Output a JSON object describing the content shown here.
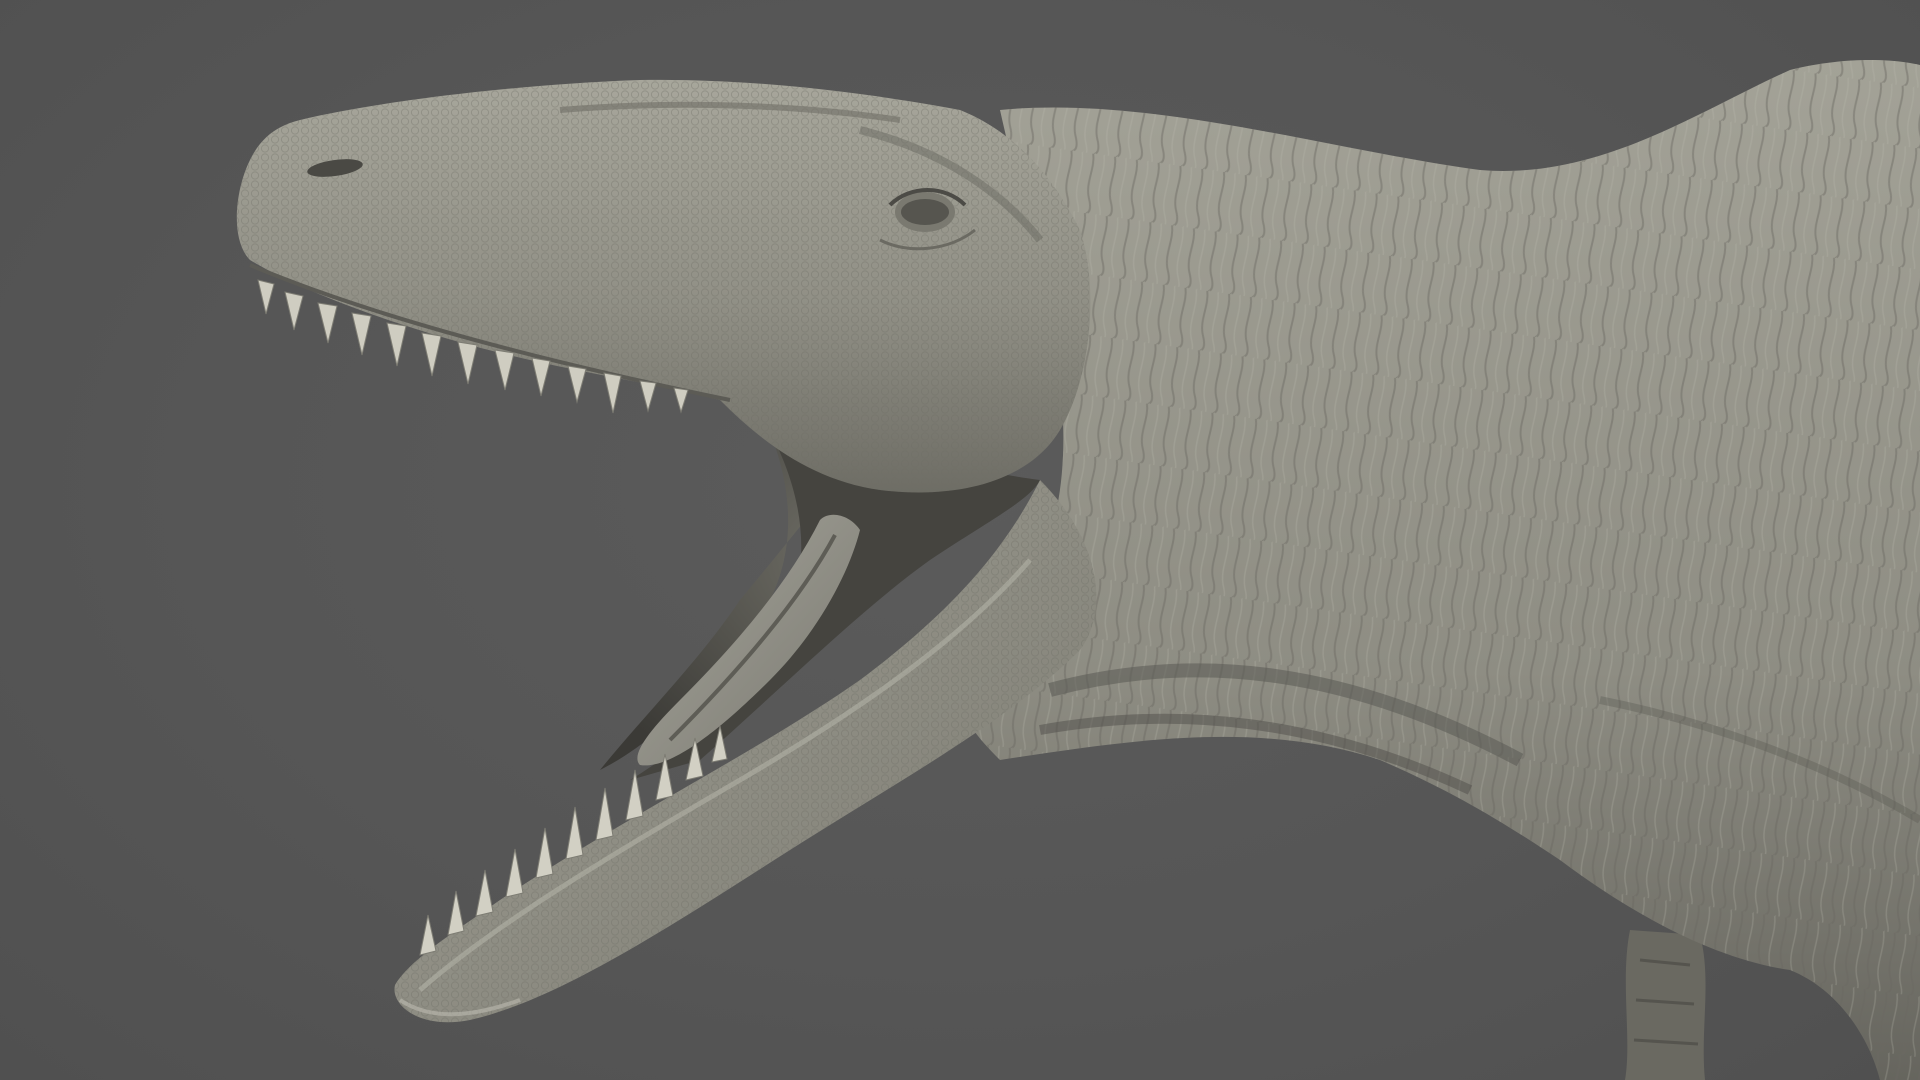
{
  "scene": {
    "subject": "sculpted-theropod-dinosaur-head",
    "view": "side-profile-open-jaw",
    "colors": {
      "background": "#555555",
      "skin_light": "#a9a89d",
      "skin_mid": "#8f8e84",
      "skin_dark": "#5f5e57",
      "mouth_shadow": "#3d3c38",
      "tongue": "#9c9b92",
      "teeth": "#d2d0c4"
    }
  }
}
